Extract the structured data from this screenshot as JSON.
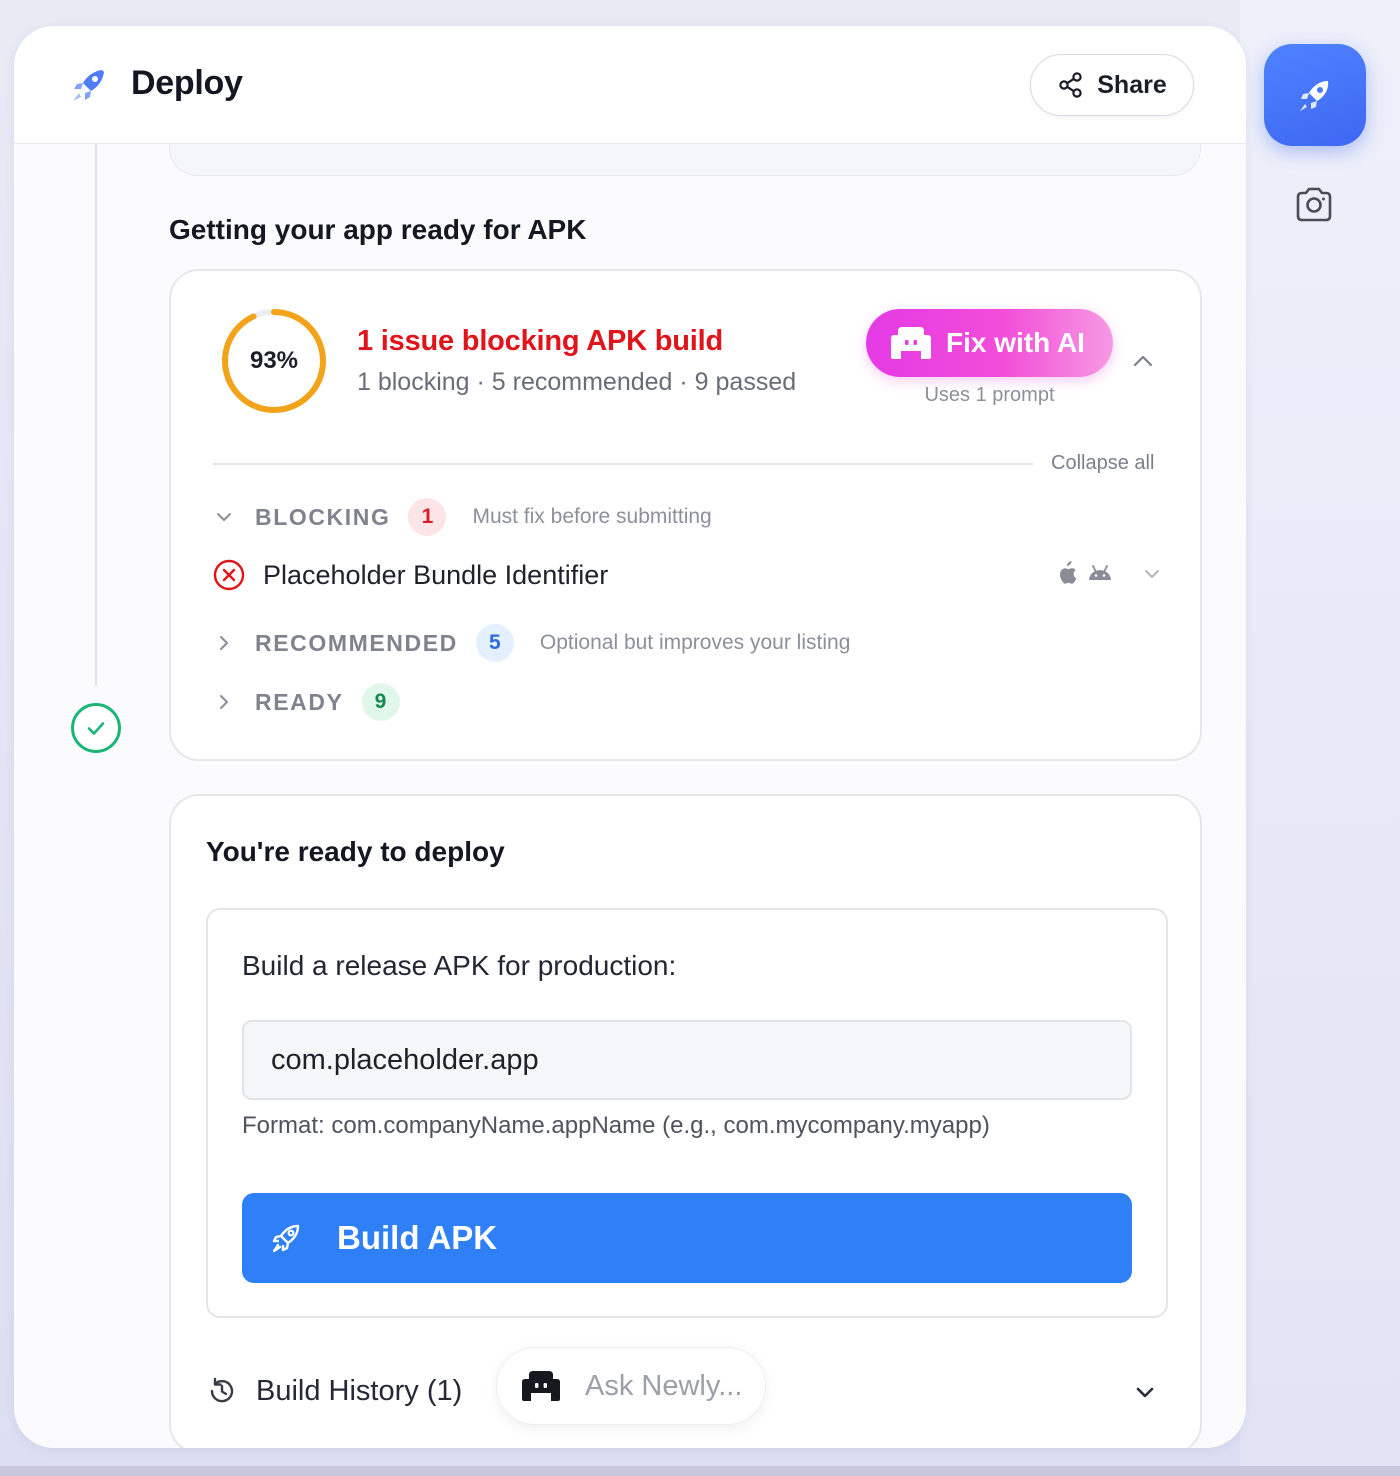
{
  "header": {
    "title": "Deploy",
    "share_label": "Share"
  },
  "section": {
    "title": "Getting your app ready for APK"
  },
  "checks": {
    "score_label": "93%",
    "score_fraction": 0.93,
    "issue_title": "1 issue blocking APK build",
    "issue_summary": "1 blocking · 5 recommended · 9 passed",
    "fix_button_label": "Fix with AI",
    "fix_note": "Uses 1 prompt",
    "collapse_all_label": "Collapse all",
    "groups": [
      {
        "label": "BLOCKING",
        "count": "1",
        "description": "Must fix before submitting",
        "color": "#d91c2a"
      },
      {
        "label": "RECOMMENDED",
        "count": "5",
        "description": "Optional but improves your listing",
        "color": "#2a6be0"
      },
      {
        "label": "READY",
        "count": "9",
        "description": "",
        "color": "#128a4d"
      }
    ],
    "blocking_items": [
      {
        "name": "Placeholder Bundle Identifier",
        "platforms": [
          "apple-icon",
          "android-icon"
        ]
      }
    ]
  },
  "deploy": {
    "title": "You're ready to deploy",
    "build_label": "Build a release APK for production:",
    "package_value": "com.placeholder.app",
    "format_hint": "Format: com.companyName.appName (e.g., com.mycompany.myapp)",
    "build_button_label": "Build APK",
    "history_label": "Build History (1)"
  },
  "assistant": {
    "placeholder": "Ask Newly..."
  },
  "colors": {
    "accent_blue": "#2f7ff7",
    "fix_gradient_start": "#e43ae6",
    "error_red": "#e0141b",
    "ring_orange": "#f2a31a",
    "success_green": "#1eb577"
  }
}
